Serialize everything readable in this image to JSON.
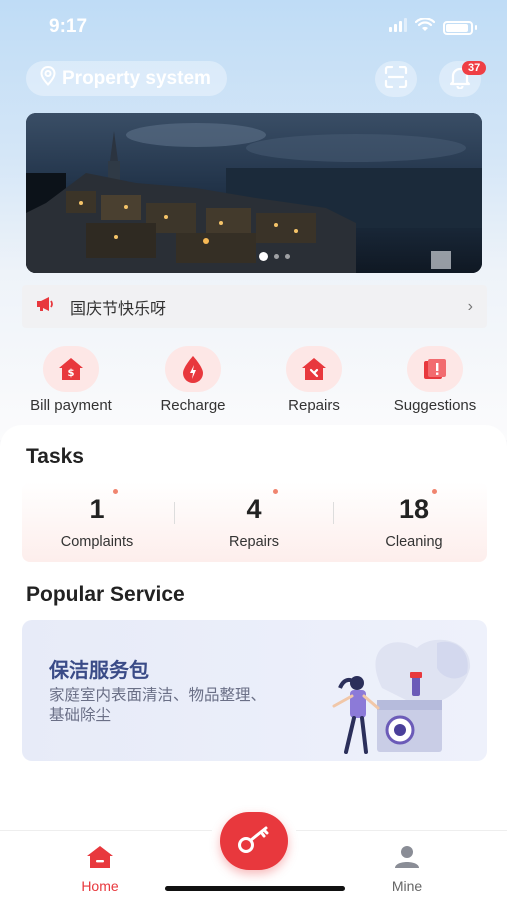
{
  "status_bar": {
    "time": "9:17"
  },
  "header": {
    "location_label": "Property system",
    "notification_count": "37"
  },
  "banner": {
    "slide_count": 3,
    "active_index": 0
  },
  "notice": {
    "text": "国庆节快乐呀"
  },
  "quick_actions": [
    {
      "label": "Bill payment",
      "icon": "bill-icon"
    },
    {
      "label": "Recharge",
      "icon": "recharge-icon"
    },
    {
      "label": "Repairs",
      "icon": "repairs-icon"
    },
    {
      "label": "Suggestions",
      "icon": "suggestions-icon"
    }
  ],
  "tasks": {
    "title": "Tasks",
    "items": [
      {
        "count": "1",
        "label": "Complaints"
      },
      {
        "count": "4",
        "label": "Repairs"
      },
      {
        "count": "18",
        "label": "Cleaning"
      }
    ]
  },
  "popular": {
    "title": "Popular Service",
    "card": {
      "title": "保洁服务包",
      "description": "家庭室内表面清洁、物品整理、基础除尘"
    }
  },
  "tabbar": {
    "home_label": "Home",
    "mine_label": "Mine"
  },
  "colors": {
    "accent": "#e8383d",
    "card_title": "#3a4b87"
  }
}
